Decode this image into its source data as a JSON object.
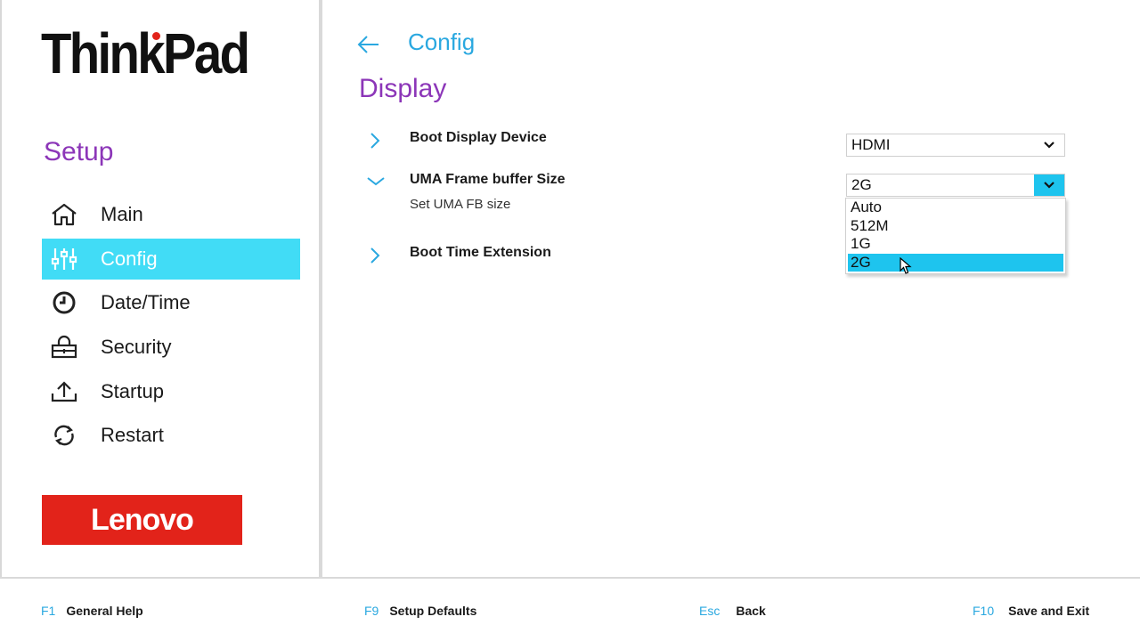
{
  "brand": {
    "name": "ThinkPad"
  },
  "sidebar": {
    "title": "Setup",
    "items": [
      {
        "label": "Main",
        "icon": "home-icon"
      },
      {
        "label": "Config",
        "icon": "sliders-icon",
        "active": true
      },
      {
        "label": "Date/Time",
        "icon": "clock-icon"
      },
      {
        "label": "Security",
        "icon": "lock-icon"
      },
      {
        "label": "Startup",
        "icon": "upload-icon"
      },
      {
        "label": "Restart",
        "icon": "refresh-icon"
      }
    ],
    "vendor_logo": "Lenovo"
  },
  "main": {
    "breadcrumb": "Config",
    "page_title": "Display",
    "settings": [
      {
        "label": "Boot Display Device",
        "value": "HDMI",
        "expanded": false
      },
      {
        "label": "UMA Frame buffer Size",
        "description": "Set UMA FB size",
        "value": "2G",
        "expanded": true
      },
      {
        "label": "Boot Time Extension",
        "expanded": false
      }
    ],
    "dropdown": {
      "options": [
        "Auto",
        "512M",
        "1G",
        "2G"
      ],
      "selected": "2G"
    }
  },
  "footer": {
    "keys": [
      {
        "key": "F1",
        "label": "General Help"
      },
      {
        "key": "F9",
        "label": "Setup Defaults"
      },
      {
        "key": "Esc",
        "label": "Back"
      },
      {
        "key": "F10",
        "label": "Save and Exit"
      }
    ]
  },
  "colors": {
    "accent_purple": "#8c36b8",
    "accent_blue": "#2aa8e0",
    "active_cyan": "#41dcf6",
    "lenovo_red": "#e2231a"
  }
}
